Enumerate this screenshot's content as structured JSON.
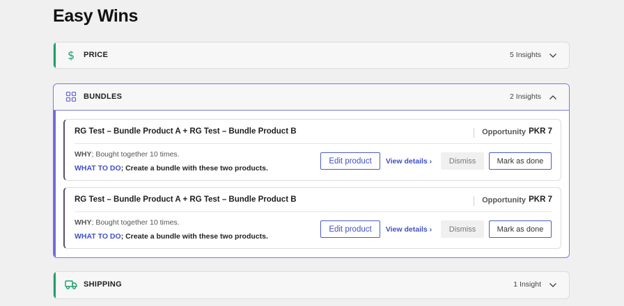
{
  "page": {
    "title": "Easy Wins"
  },
  "colors": {
    "price_accent": "#1f9d6b",
    "bundles_accent": "#6f6bd8",
    "shipping_accent": "#1f9d6b",
    "link": "#3f4fc8"
  },
  "panels": {
    "price": {
      "label": "PRICE",
      "count": "5 Insights",
      "icon": "dollar-icon",
      "expanded": false
    },
    "bundles": {
      "label": "BUNDLES",
      "count": "2 Insights",
      "icon": "grid-icon",
      "expanded": true
    },
    "shipping": {
      "label": "SHIPPING",
      "count": "1 Insight",
      "icon": "truck-icon",
      "expanded": false
    }
  },
  "bundle_cards": [
    {
      "title": "RG Test – Bundle Product A + RG Test – Bundle Product B",
      "opportunity_label": "Opportunity",
      "opportunity_value": "PKR 7",
      "why_key": "WHY",
      "why_text": "; Bought together 10 times.",
      "todo_key": "WHAT TO DO",
      "todo_text": "; Create a bundle with these two products.",
      "edit_label": "Edit product",
      "view_label": "View details ›",
      "dismiss_label": "Dismiss",
      "done_label": "Mark as done"
    },
    {
      "title": "RG Test – Bundle Product A + RG Test – Bundle Product B",
      "opportunity_label": "Opportunity",
      "opportunity_value": "PKR 7",
      "why_key": "WHY",
      "why_text": "; Bought together 10 times.",
      "todo_key": "WHAT TO DO",
      "todo_text": "; Create a bundle with these two products.",
      "edit_label": "Edit product",
      "view_label": "View details ›",
      "dismiss_label": "Dismiss",
      "done_label": "Mark as done"
    }
  ]
}
